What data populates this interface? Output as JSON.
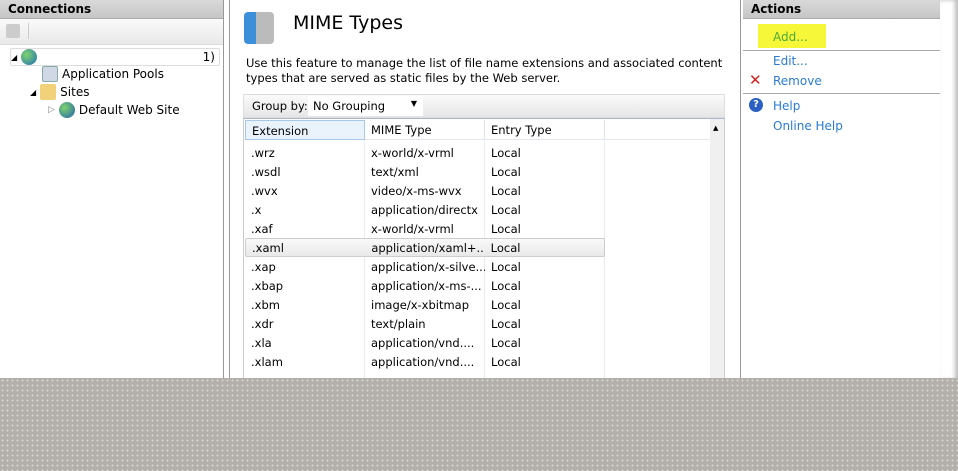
{
  "connections": {
    "title": "Connections",
    "tree": {
      "server_suffix": "1)",
      "app_pools": "Application Pools",
      "sites": "Sites",
      "default_site": "Default Web Site"
    }
  },
  "feature": {
    "title": "MIME Types",
    "description": "Use this feature to manage the list of file name extensions and associated content types that are served as static files by the Web server.",
    "group_by_label": "Group by:",
    "group_by_value": "No Grouping"
  },
  "table": {
    "columns": [
      "Extension",
      "MIME Type",
      "Entry Type"
    ],
    "rows": [
      [
        ".wrz",
        "x-world/x-vrml",
        "Local"
      ],
      [
        ".wsdl",
        "text/xml",
        "Local"
      ],
      [
        ".wvx",
        "video/x-ms-wvx",
        "Local"
      ],
      [
        ".x",
        "application/directx",
        "Local"
      ],
      [
        ".xaf",
        "x-world/x-vrml",
        "Local"
      ],
      [
        ".xaml",
        "application/xaml+...",
        "Local"
      ],
      [
        ".xap",
        "application/x-silve...",
        "Local"
      ],
      [
        ".xbap",
        "application/x-ms-...",
        "Local"
      ],
      [
        ".xbm",
        "image/x-xbitmap",
        "Local"
      ],
      [
        ".xdr",
        "text/plain",
        "Local"
      ],
      [
        ".xla",
        "application/vnd....",
        "Local"
      ],
      [
        ".xlam",
        "application/vnd....",
        "Local"
      ]
    ],
    "selected_index": 5
  },
  "actions": {
    "title": "Actions",
    "add": "Add...",
    "edit": "Edit...",
    "remove": "Remove",
    "help": "Help",
    "online_help": "Online Help",
    "highlight_color": "#f7f73a"
  }
}
